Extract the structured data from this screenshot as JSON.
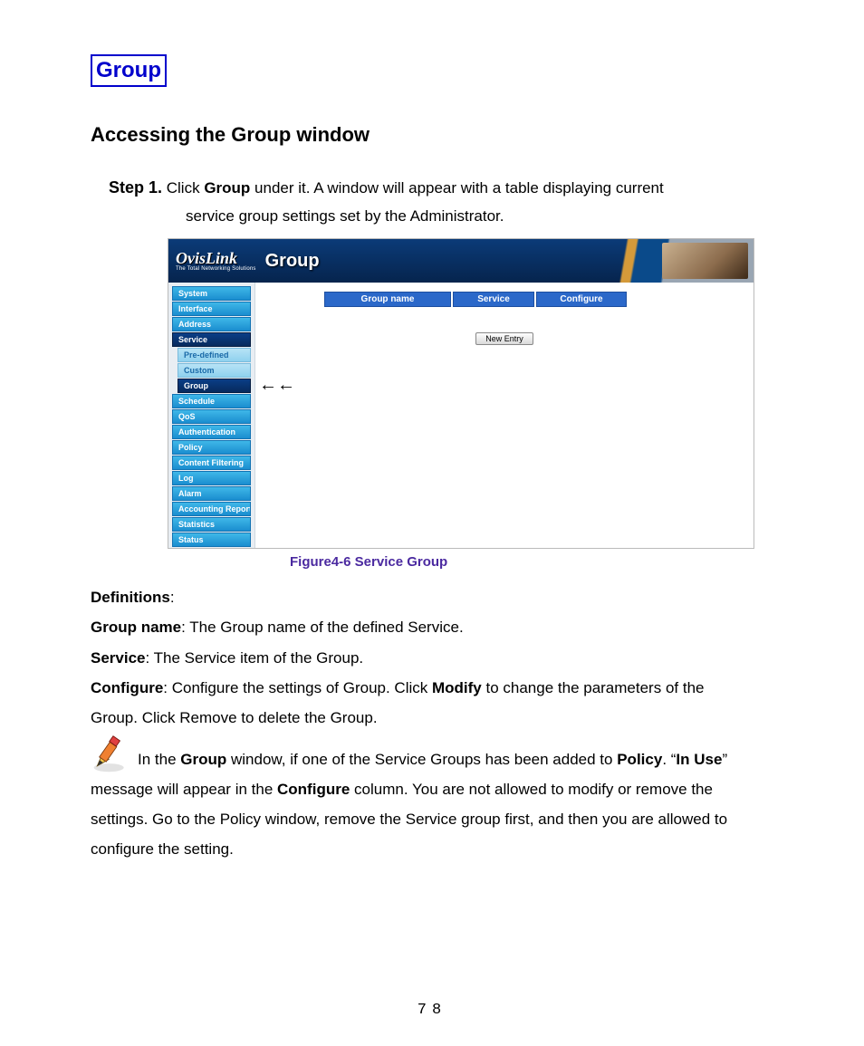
{
  "page_number": "78",
  "section_title": "Group",
  "subheading": "Accessing the Group window",
  "step": {
    "label": "Step 1.",
    "pre": " Click ",
    "bold1": "Group",
    "mid": " under it.    A window will appear with a table displaying current",
    "line2": "service group settings set by the Administrator."
  },
  "screenshot": {
    "brand_top": "OvisLink",
    "brand_sub": "The Total Networking Solutions",
    "header_title": "Group",
    "nav": {
      "items": [
        "System",
        "Interface",
        "Address",
        "Service",
        "Schedule",
        "QoS",
        "Authentication",
        "Policy",
        "Content Filtering",
        "Log",
        "Alarm",
        "Accounting Report",
        "Statistics",
        "Status"
      ],
      "service_sub": [
        "Pre-defined",
        "Custom",
        "Group"
      ],
      "selected_top": "Service",
      "selected_sub": "Group"
    },
    "columns": [
      "Group name",
      "Service",
      "Configure"
    ],
    "new_entry_label": "New Entry",
    "pointer": "←←"
  },
  "caption": "Figure4-6 Service Group",
  "defs": {
    "heading": "Definitions",
    "group_name_k": "Group name",
    "group_name_v": ": The Group name of the defined Service.",
    "service_k": "Service",
    "service_v": ": The Service item of the Group.",
    "configure_k": "Configure",
    "configure_v1": ":    Configure the settings of Group. Click ",
    "modify": "Modify",
    "configure_v2": " to change the parameters of the",
    "configure_line2": "Group. Click Remove to delete the Group."
  },
  "note": {
    "p1a": " In the ",
    "group": "Group",
    "p1b": " window, if one of the Service Groups has been added to ",
    "policy": "Policy",
    "p1c": ". “",
    "inuse": "In Use",
    "p1d": "”",
    "l2a": "message will appear in the ",
    "conf": "Configure",
    "l2b": " column. You are not allowed to modify or remove the",
    "l3": "settings. Go to the Policy window, remove the Service group first, and then you are allowed to",
    "l4": "configure the setting."
  }
}
